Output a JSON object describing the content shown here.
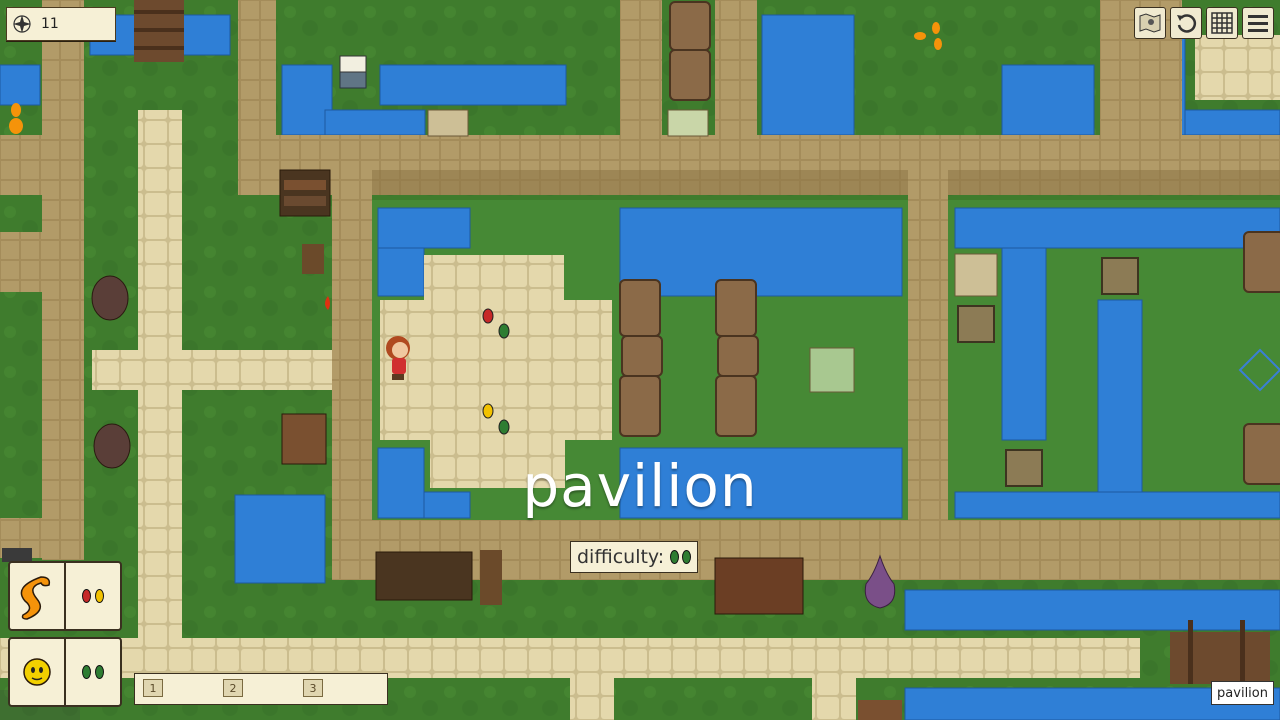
{
  "hud": {
    "star_count": "11",
    "level_name": "pavilion",
    "difficulty_label": "difficulty:",
    "location_tag": "pavilion",
    "slot_labels": [
      "1",
      "2",
      "3"
    ]
  },
  "icons": {
    "star": "compass-star-icon",
    "map": "map-icon",
    "undo": "undo-icon",
    "grid": "grid-icon",
    "menu": "menu-icon"
  },
  "colors": {
    "grass": "#3e7a2c",
    "water": "#2f7fd6",
    "stone_wall": "#a8915e",
    "path": "#e2d4a6",
    "hud_bg": "#f6f0d6",
    "bean_red": "#c62828",
    "bean_green": "#2e7d32",
    "bean_yellow": "#f2c200"
  }
}
